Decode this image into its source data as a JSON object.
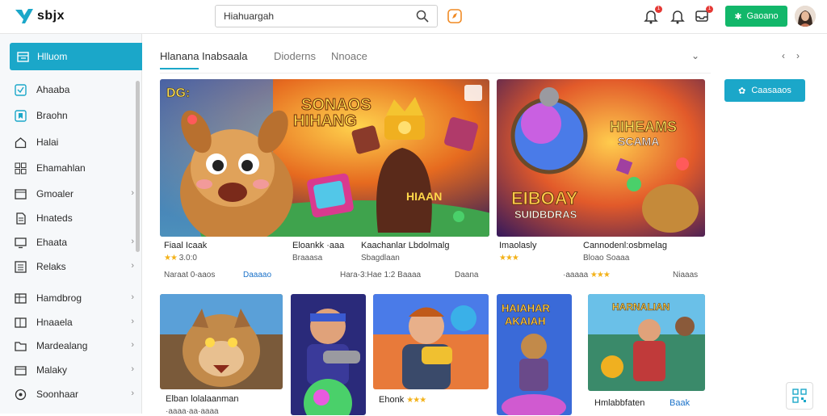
{
  "header": {
    "logo_text": "sbjx",
    "search_value": "Hiahuargah",
    "action_button_label": "Gaoano",
    "notification_badge_1": "1",
    "notification_badge_2": "1"
  },
  "sidebar": {
    "active_label": "Hlluom",
    "items": [
      {
        "label": "Ahaaba",
        "icon": "check-square-icon",
        "chevron": false
      },
      {
        "label": "Braohn",
        "icon": "bookmark-square-icon",
        "chevron": false
      },
      {
        "label": "Halai",
        "icon": "home-icon",
        "chevron": false
      },
      {
        "label": "Ehamahlan",
        "icon": "grid-icon",
        "chevron": false
      },
      {
        "label": "Gmoaler",
        "icon": "window-icon",
        "chevron": true
      },
      {
        "label": "Hnateds",
        "icon": "document-icon",
        "chevron": false
      },
      {
        "label": "Ehaata",
        "icon": "desktop-icon",
        "chevron": true
      },
      {
        "label": "Relaks",
        "icon": "list-icon",
        "chevron": true
      },
      {
        "label": "Hamdbrog",
        "icon": "table-icon",
        "chevron": true
      },
      {
        "label": "Hnaaela",
        "icon": "layout-icon",
        "chevron": true
      },
      {
        "label": "Mardealang",
        "icon": "folder-icon",
        "chevron": true
      },
      {
        "label": "Malaky",
        "icon": "box-icon",
        "chevron": true
      },
      {
        "label": "Soonhaar",
        "icon": "circle-icon",
        "chevron": true
      }
    ]
  },
  "tabs": {
    "items": [
      "Hlanana Inabsaala",
      "Dioderns",
      "Nnoace"
    ]
  },
  "right_button_label": "Caasaaos",
  "featured": [
    {
      "image_text": [
        "SONAOS",
        "HIHANG"
      ],
      "corner_text": "DG:",
      "title": "Fiaal Icaak",
      "rating": "3.0:0",
      "footer_left": "Naraat 0-aaos",
      "footer_link": "Daaaao"
    },
    {
      "image_text": [
        "HIAAN"
      ],
      "title": "Eloankk",
      "title_suffix": "·aaa",
      "subtitle": "Braaasa",
      "title2": "Kaachanlar Lbdolmalg",
      "subtitle2": "Sbagdlaan",
      "footer_mid": "Hara-3:Hae 1:2 Baaaa",
      "footer_right": "Daana"
    },
    {
      "image_text": [
        "HIHEAMS",
        "SCAMA",
        "EIBOAY",
        "SUIDBDRAS"
      ],
      "title": "Imaolasly",
      "title2": "Cannodenl:osbmelag",
      "subtitle2": "Bloao Soaaa",
      "footer_mid": "·aaaaa",
      "footer_right": "Niaaas"
    }
  ],
  "second_row": [
    {
      "title": "Elban lolalaanman",
      "rating": "·aaaa·aa·aaaa",
      "image_text": []
    },
    {
      "title": "",
      "image_text": []
    },
    {
      "title": "Ehonk",
      "image_text": []
    },
    {
      "title": "",
      "image_text": [
        "HAIAHAR",
        "AKAIAH"
      ]
    },
    {
      "title": "Hmlabbfaten",
      "link": "Baak",
      "image_text": [
        "HARNALIAN"
      ]
    }
  ],
  "colors": {
    "accent": "#1ba7c9",
    "green": "#12b76a",
    "star": "#f3b21a"
  }
}
